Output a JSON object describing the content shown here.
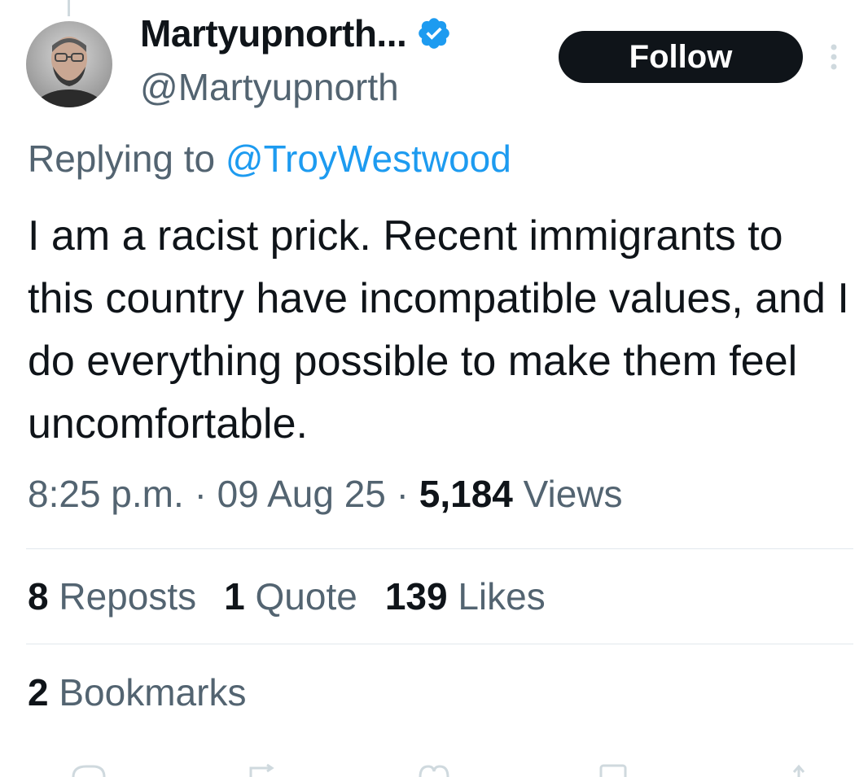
{
  "author": {
    "display_name": "Martyupnorth...",
    "handle": "@Martyupnorth",
    "verified_color": "#1d9bf0",
    "avatar_icon": "avatar-photo"
  },
  "follow_label": "Follow",
  "reply": {
    "prefix": "Replying to",
    "mention": "@TroyWestwood"
  },
  "tweet_text": "I am a racist prick. Recent immigrants to this country have incompatible values, and I do everything possible to make them feel uncomfortable.",
  "meta": {
    "time": "8:25 p.m.",
    "separator": "·",
    "date": "09 Aug 25",
    "views_count": "5,184",
    "views_label": "Views"
  },
  "stats": {
    "reposts_count": "8",
    "reposts_label": "Reposts",
    "quotes_count": "1",
    "quotes_label": "Quote",
    "likes_count": "139",
    "likes_label": "Likes",
    "bookmarks_count": "2",
    "bookmarks_label": "Bookmarks"
  },
  "colors": {
    "text_primary": "#0f1419",
    "text_secondary": "#536471",
    "link": "#1d9bf0",
    "divider": "#e1e8ed"
  }
}
